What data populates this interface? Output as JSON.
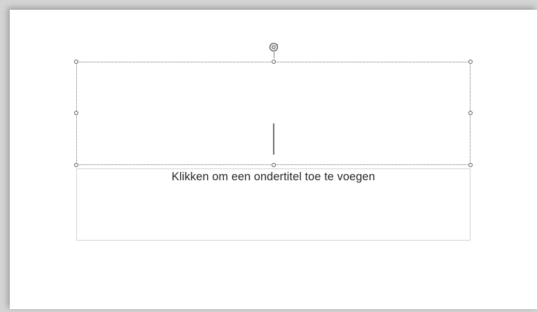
{
  "slide": {
    "title_placeholder": {
      "selected": true,
      "text": ""
    },
    "subtitle_placeholder": {
      "text": "Klikken om een ondertitel toe te voegen"
    }
  },
  "icons": {
    "rotate": "rotate-handle-icon"
  },
  "colors": {
    "workspace": "#d4d4d4",
    "slide_background": "#ffffff",
    "selection_border": "#6a6a6a",
    "placeholder_text": "#262626"
  }
}
